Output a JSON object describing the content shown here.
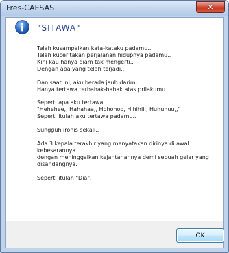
{
  "window": {
    "title": "Fres-CAESAS",
    "close_glyph": "✕"
  },
  "dialog": {
    "icon": "information-icon",
    "heading": "\"SITAWA\"",
    "paragraphs": [
      "Telah kusampaikan kata-kataku padamu..\nTelah kuceritakan perjalanan hidupnya padamu..\nKini kau hanya diam tak mengerti..\nDengan apa yang telah terjadi..",
      "Dan saat ini, aku berada jauh darimu..\nHanya tertawa terbahak-bahak atas prilakumu..",
      "Seperti apa aku tertawa,\n\"Hehehee,, Hahahaa,, Hohohoo, Hihihii,, Huhuhuu,,\"\nSeperti itulah aku tertawa padamu..",
      "Sungguh ironis sekali..",
      "Ada 3 kepala terakhir yang menyatakan dirinya di  awal kebesarannya\ndengan meninggalkan kejantanannya  demi sebuah gelar yang\ndisandangnya.",
      "Seperti itulah \"Dia\"."
    ],
    "ok_label": "OK"
  },
  "colors": {
    "close_button": "#c2371f",
    "heading": "#1d3d8a",
    "icon_blue": "#2f6fc9"
  }
}
